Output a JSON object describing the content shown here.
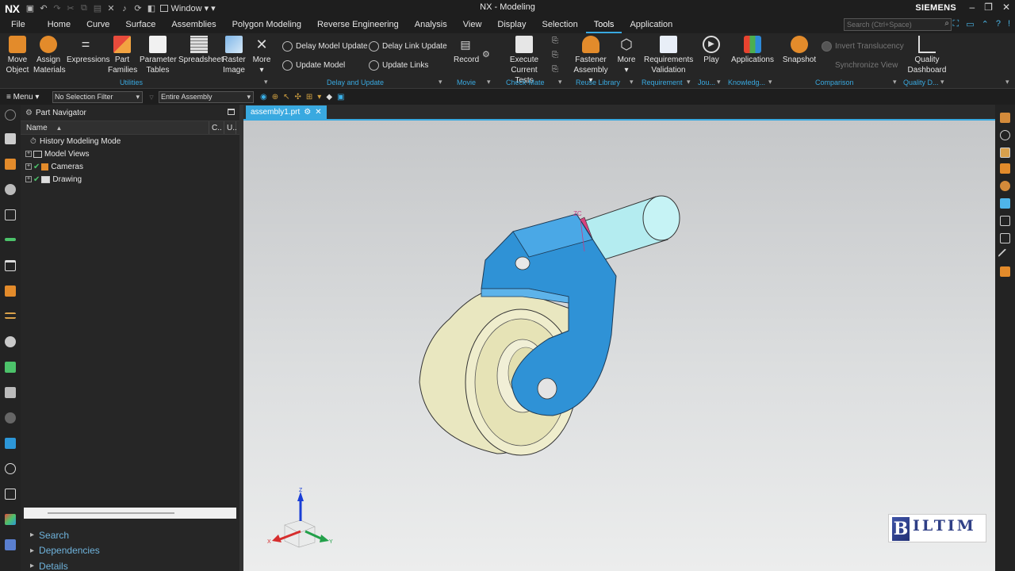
{
  "titlebar": {
    "logo": "NX",
    "window_label": "Window",
    "app_title": "NX - Modeling",
    "brand": "SIEMENS"
  },
  "tabs": [
    "File",
    "Home",
    "Curve",
    "Surface",
    "Assemblies",
    "Polygon Modeling",
    "Reverse Engineering",
    "Analysis",
    "View",
    "Display",
    "Selection",
    "Tools",
    "Application"
  ],
  "active_tab": "Tools",
  "search": {
    "placeholder": "Search (Ctrl+Space)"
  },
  "ribbon": {
    "move_object": [
      "Move",
      "Object"
    ],
    "assign_materials": [
      "Assign",
      "Materials"
    ],
    "expressions": "Expressions",
    "part_families": [
      "Part",
      "Families"
    ],
    "parameter_tables": [
      "Parameter",
      "Tables"
    ],
    "spreadsheet": "Spreadsheet",
    "raster_image": [
      "Raster",
      "Image"
    ],
    "more_1": "More",
    "delay_model_update": "Delay Model Update",
    "update_model": "Update Model",
    "delay_link_update": "Delay Link Update",
    "update_links": "Update Links",
    "record": "Record",
    "execute_current_tests": [
      "Execute",
      "Current Tests"
    ],
    "fastener_assembly": [
      "Fastener",
      "Assembly ▾"
    ],
    "more_2": "More",
    "requirements_validation": [
      "Requirements",
      "Validation"
    ],
    "play": "Play",
    "applications": "Applications",
    "snapshot": "Snapshot",
    "invert_translucency": "Invert Translucency",
    "synchronize_view": "Synchronize View",
    "quality_dashboard": [
      "Quality",
      "Dashboard"
    ],
    "groups": {
      "utilities": "Utilities",
      "delay_and_update": "Delay and Update",
      "movie": "Movie",
      "check_mate": "Check-Mate",
      "reuse_library": "Reuse Library",
      "requirement": "Requirement",
      "journal": "Jou...",
      "knowledge": "Knowledg...",
      "comparison": "Comparison",
      "quality": "Quality D..."
    }
  },
  "filterbar": {
    "menu_label": "Menu ▾",
    "selection_filter": "No Selection Filter",
    "scope": "Entire Assembly"
  },
  "navigator": {
    "title": "Part Navigator",
    "columns": [
      "Name",
      "C..",
      "U.."
    ],
    "items": [
      {
        "label": "History Modeling Mode"
      },
      {
        "label": "Model Views"
      },
      {
        "label": "Cameras"
      },
      {
        "label": "Drawing"
      }
    ],
    "sections": [
      "Search",
      "Dependencies",
      "Details"
    ]
  },
  "document": {
    "tab_label": "assembly1.prt"
  },
  "triad": {
    "z": "Z",
    "x": "X",
    "y": "Y"
  },
  "model": {
    "csys_label": "ZC"
  },
  "watermark": {
    "name": "BILTIM",
    "initial": "B"
  },
  "colors": {
    "accent": "#39a9e0",
    "bracket": "#2f92d6",
    "wheel": "#e9e7c0",
    "shaft": "#b4ecf0"
  }
}
